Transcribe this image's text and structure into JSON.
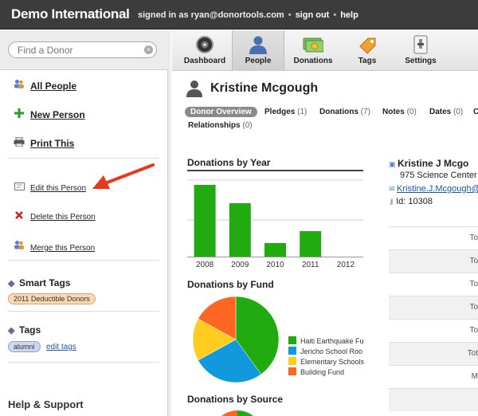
{
  "app": {
    "title": "Demo International",
    "signed_in": "signed in as ryan@donortools.com",
    "sign_out": "sign out",
    "help": "help"
  },
  "search": {
    "placeholder": "Find a Donor"
  },
  "sidebar": {
    "main": [
      {
        "label": "All People",
        "icon": "people-icon"
      },
      {
        "label": "New Person",
        "icon": "plus-icon"
      },
      {
        "label": "Print This",
        "icon": "printer-icon"
      }
    ],
    "actions": [
      {
        "label": "Edit this Person",
        "icon": "edit-icon"
      },
      {
        "label": "Delete this Person",
        "icon": "delete-icon"
      },
      {
        "label": "Merge this Person",
        "icon": "merge-icon"
      }
    ],
    "smart_tags": {
      "title": "Smart Tags",
      "tags": [
        "2011 Deductible Donors"
      ]
    },
    "tags": {
      "title": "Tags",
      "tags": [
        "alumni"
      ],
      "edit_label": "edit tags"
    },
    "help_title": "Help & Support"
  },
  "toolbar": {
    "items": [
      {
        "label": "Dashboard",
        "icon": "dashboard-icon"
      },
      {
        "label": "People",
        "icon": "person-icon",
        "active": true
      },
      {
        "label": "Donations",
        "icon": "money-icon"
      },
      {
        "label": "Tags",
        "icon": "tag-icon"
      },
      {
        "label": "Settings",
        "icon": "settings-icon"
      }
    ]
  },
  "person": {
    "name": "Kristine Mcgough",
    "full_name": "Kristine J Mcgo",
    "address": "975 Science Center",
    "email": "Kristine.J.Mcgough@",
    "id": "Id: 10308"
  },
  "tabs": [
    {
      "label": "Donor Overview",
      "count": "",
      "active": true
    },
    {
      "label": "Pledges",
      "count": "(1)"
    },
    {
      "label": "Donations",
      "count": "(7)"
    },
    {
      "label": "Notes",
      "count": "(0)"
    },
    {
      "label": "Dates",
      "count": "(0)"
    },
    {
      "label": "C",
      "count": ""
    },
    {
      "label": "Relationships",
      "count": "(0)"
    }
  ],
  "right_table": [
    "To",
    "To",
    "To",
    "To",
    "To",
    "Tot",
    "M",
    "",
    ""
  ],
  "colors": {
    "bar": "#22aa11",
    "fund1": "#22aa11",
    "fund2": "#1199dd",
    "fund3": "#ffcc22",
    "fund4": "#ff6622",
    "arrow": "#e8381c"
  },
  "chart_data": [
    {
      "type": "bar",
      "title": "Donations by Year",
      "categories": [
        "2008",
        "2009",
        "2010",
        "2011",
        "2012"
      ],
      "values": [
        90,
        67,
        17,
        32,
        0
      ],
      "xlabel": "",
      "ylabel": "",
      "ylim": [
        0,
        100
      ],
      "grid": true
    },
    {
      "type": "pie",
      "title": "Donations by Fund",
      "categories": [
        "Haiti Earthquake Fu",
        "Jericho School Roo",
        "Elementary Schools",
        "Building Fund"
      ],
      "values": [
        40,
        27,
        16,
        17
      ],
      "legend": "right"
    },
    {
      "type": "pie",
      "title": "Donations by Source",
      "categories": [],
      "values": []
    }
  ]
}
